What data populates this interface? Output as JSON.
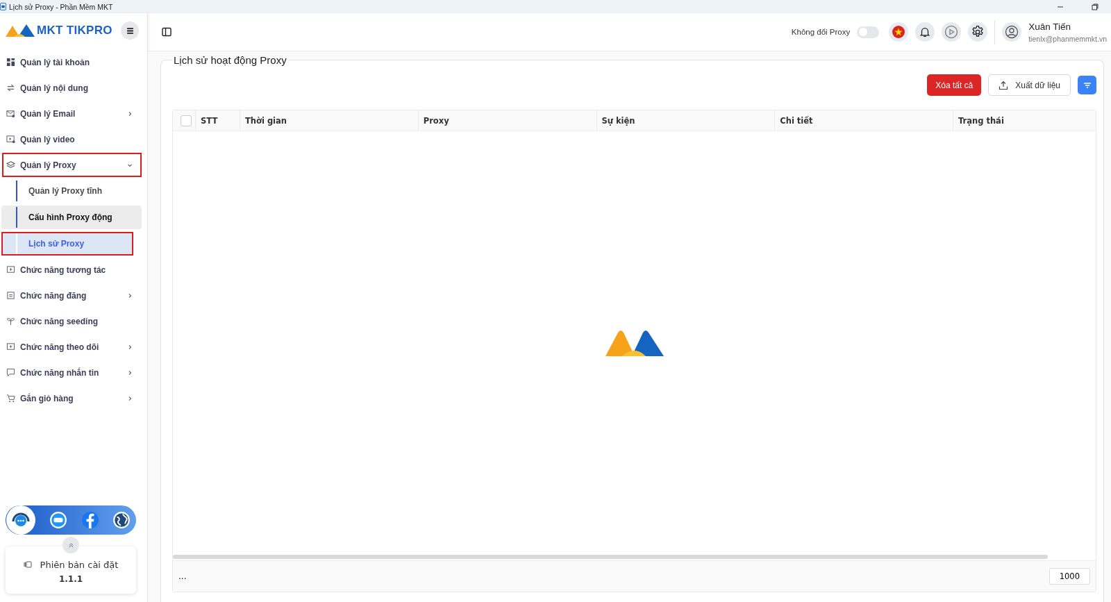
{
  "window": {
    "title": "Lịch sử Proxy - Phần Mềm MKT"
  },
  "sidebar": {
    "logo": "MKT TIKPRO",
    "items": [
      {
        "label": "Quản lý tài khoản",
        "highlighted": false
      },
      {
        "label": "Quản lý nội dung",
        "highlighted": false
      },
      {
        "label": "Quản lý Email",
        "expanded": false,
        "highlighted": false
      },
      {
        "label": "Quản lý video",
        "highlighted": false
      },
      {
        "label": "Quản lý Proxy",
        "expanded": true,
        "highlighted": true,
        "children": [
          {
            "label": "Quản lý Proxy tĩnh",
            "selected": false,
            "hovered": false,
            "highlighted": false
          },
          {
            "label": "Cấu hình Proxy động",
            "selected": false,
            "hovered": true,
            "highlighted": false
          },
          {
            "label": "Lịch sử Proxy",
            "selected": true,
            "hovered": false,
            "highlighted": true
          }
        ]
      },
      {
        "label": "Chức năng tương tác",
        "highlighted": false
      },
      {
        "label": "Chức năng đăng",
        "expanded": false,
        "highlighted": false
      },
      {
        "label": "Chức năng seeding",
        "highlighted": false
      },
      {
        "label": "Chức năng theo dõi",
        "expanded": false,
        "highlighted": false
      },
      {
        "label": "Chức năng nhắn tin",
        "expanded": false,
        "highlighted": false
      },
      {
        "label": "Gắn giỏ hàng",
        "expanded": false,
        "highlighted": false
      }
    ],
    "version": {
      "label": "Phiên bản cài đặt",
      "number": "1.1.1"
    }
  },
  "header": {
    "proxy_toggle": {
      "label": "Không đổi Proxy",
      "on": false
    },
    "user": {
      "name": "Xuân Tiến",
      "email": "tienlx@phanmemmkt.vn"
    }
  },
  "page": {
    "title": "Lịch sử hoạt động Proxy",
    "buttons": [
      {
        "label": "Xóa tất cả",
        "kind": "danger"
      },
      {
        "label": "Xuất dữ liệu",
        "kind": "export"
      },
      {
        "kind": "filter"
      }
    ],
    "table": {
      "columns": [
        "STT",
        "Thời gian",
        "Proxy",
        "Sự kiện",
        "Chi tiết",
        "Trạng thái"
      ],
      "all_checked": false
    },
    "footer": {
      "pager": "...",
      "page_size": "1000"
    }
  }
}
